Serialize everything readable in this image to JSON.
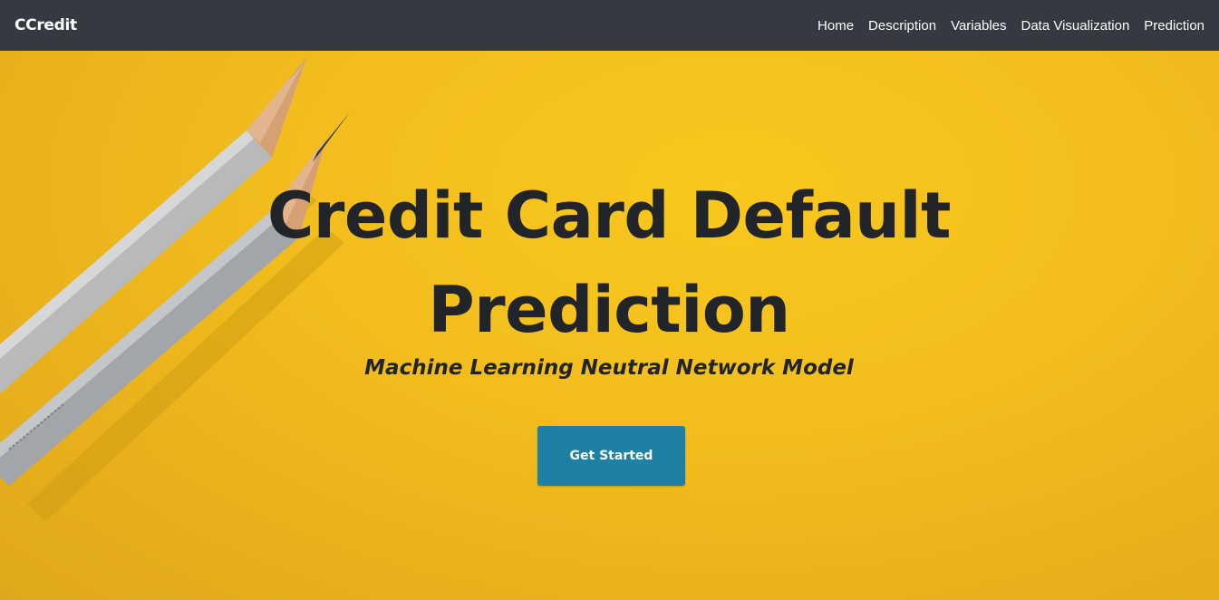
{
  "navbar": {
    "brand": "CCredit",
    "items": [
      {
        "label": "Home"
      },
      {
        "label": "Description"
      },
      {
        "label": "Variables"
      },
      {
        "label": "Data Visualization"
      },
      {
        "label": "Prediction"
      }
    ]
  },
  "hero": {
    "title": "Credit Card Default Prediction",
    "subtitle": "Machine Learning Neutral Network Model",
    "cta_label": "Get Started",
    "background_image": "pencils-on-yellow-paper"
  },
  "colors": {
    "navbar_bg": "#343a40",
    "hero_bg": "#f3be1d",
    "button_bg": "#1d80a4",
    "text_dark": "#212529"
  }
}
